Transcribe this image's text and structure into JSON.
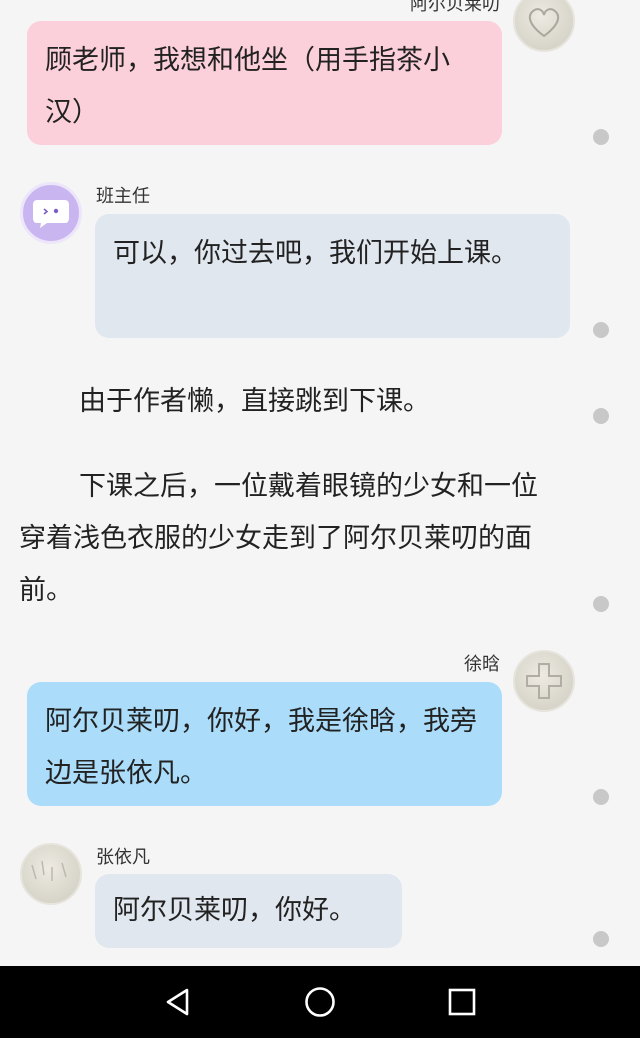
{
  "messages": [
    {
      "sender": "阿尔贝莱叨",
      "side": "right",
      "text": "顾老师，我想和他坐（用手指茶小汉）"
    },
    {
      "sender": "班主任",
      "side": "left",
      "text": "可以，你过去吧，我们开始上课。"
    },
    {
      "sender": "徐晗",
      "side": "right",
      "text": "阿尔贝莱叨，你好，我是徐晗，我旁边是张依凡。"
    },
    {
      "sender": "张依凡",
      "side": "left",
      "text": "阿尔贝莱叨，你好。"
    }
  ],
  "narration": [
    "由于作者懒，直接跳到下课。",
    "下课之后，一位戴着眼镜的少女和一位穿着浅色衣服的少女走到了阿尔贝莱叨的面前。"
  ],
  "colors": {
    "bubble_pink": "#fcd0da",
    "bubble_gray": "#e1e7ef",
    "bubble_blue": "#abdcf9",
    "avatar_purple": "#c9b6f1",
    "navbar": "#000000"
  },
  "icons": {
    "avatar_1": "heart-sketch-avatar",
    "avatar_2": "chat-face-avatar",
    "avatar_3": "cross-sketch-avatar",
    "avatar_4": "paper-sketch-avatar",
    "nav_back": "triangle-back-icon",
    "nav_home": "circle-home-icon",
    "nav_recents": "square-recents-icon"
  }
}
